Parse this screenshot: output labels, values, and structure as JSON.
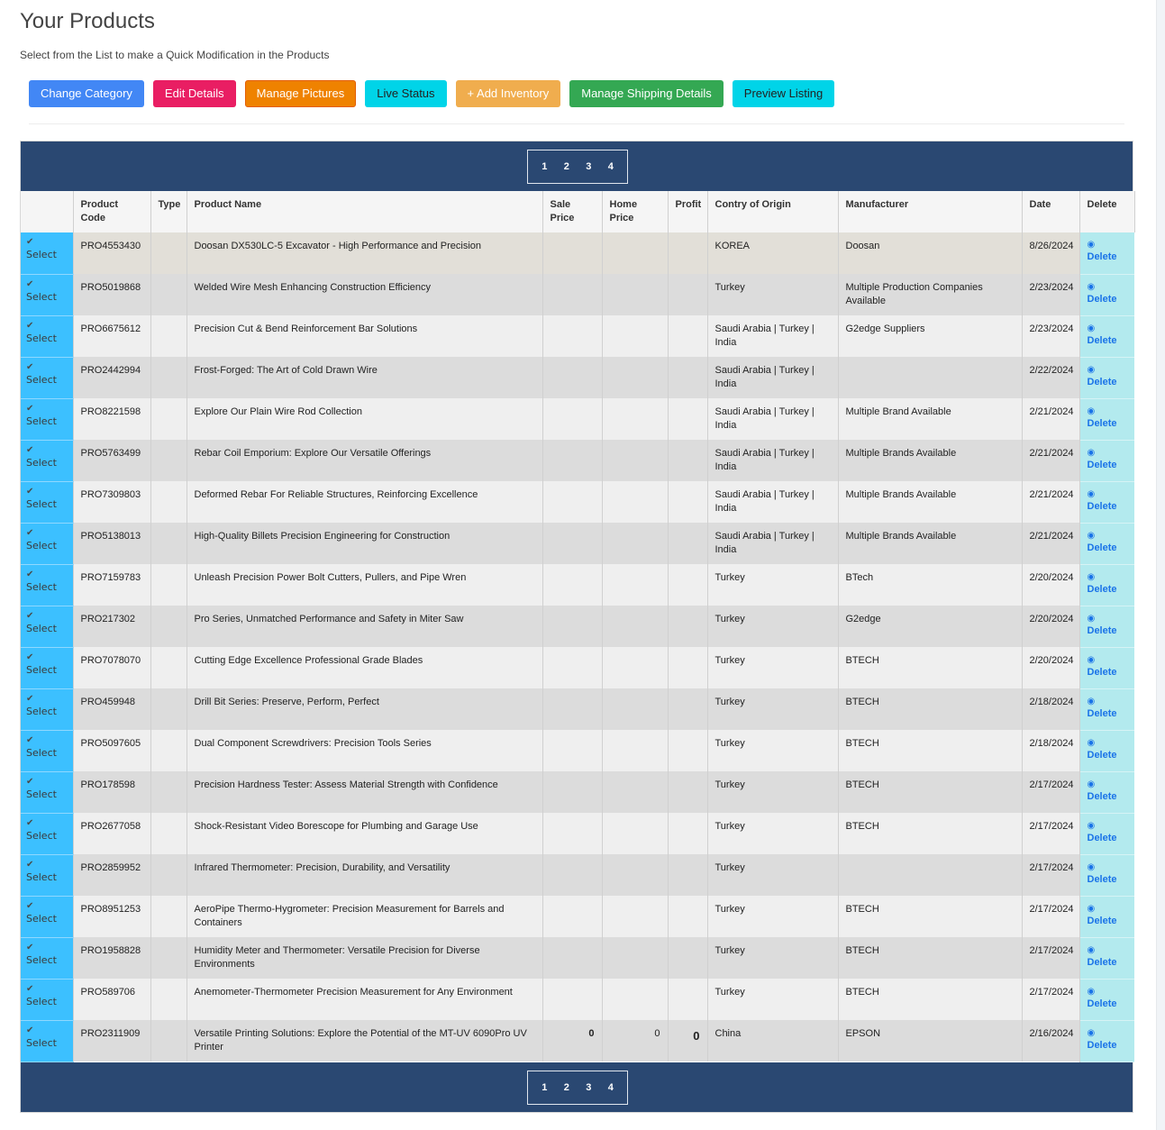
{
  "header": {
    "title": "Your Products",
    "subtitle": "Select from the List to make a Quick Modification in the Products"
  },
  "toolbar": {
    "change_category": "Change Category",
    "edit_details": "Edit Details",
    "manage_pictures": "Manage Pictures",
    "live_status": "Live Status",
    "add_inventory": "+ Add Inventory",
    "manage_shipping": "Manage Shipping Details",
    "preview_listing": "Preview Listing"
  },
  "pagination": {
    "pages": [
      "1",
      "2",
      "3",
      "4"
    ]
  },
  "table": {
    "columns": {
      "select": "",
      "code": "Product Code",
      "type": "Type",
      "name": "Product Name",
      "sale_price": "Sale Price",
      "home_price": "Home Price",
      "profit": "Profit",
      "origin": "Contry of Origin",
      "manufacturer": "Manufacturer",
      "date": "Date",
      "delete": "Delete"
    },
    "select_label": "Select",
    "delete_label": "Delete",
    "icons": {
      "select": "check-icon",
      "delete": "eye-icon"
    },
    "rows": [
      {
        "code": "PRO4553430",
        "type": "",
        "name": "Doosan DX530LC-5 Excavator - High Performance and Precision",
        "sale": "",
        "home": "",
        "profit": "",
        "origin": "KOREA",
        "manufacturer": "Doosan",
        "date": "8/26/2024"
      },
      {
        "code": "PRO5019868",
        "type": "",
        "name": "Welded Wire Mesh Enhancing Construction Efficiency",
        "sale": "",
        "home": "",
        "profit": "",
        "origin": "Turkey",
        "manufacturer": "Multiple Production Companies Available",
        "date": "2/23/2024"
      },
      {
        "code": "PRO6675612",
        "type": "",
        "name": "Precision Cut & Bend Reinforcement Bar Solutions",
        "sale": "",
        "home": "",
        "profit": "",
        "origin": "Saudi Arabia | Turkey | India",
        "manufacturer": "G2edge Suppliers",
        "date": "2/23/2024"
      },
      {
        "code": "PRO2442994",
        "type": "",
        "name": "Frost-Forged: The Art of Cold Drawn Wire",
        "sale": "",
        "home": "",
        "profit": "",
        "origin": "Saudi Arabia | Turkey | India",
        "manufacturer": "",
        "date": "2/22/2024"
      },
      {
        "code": "PRO8221598",
        "type": "",
        "name": "Explore Our Plain Wire Rod Collection",
        "sale": "",
        "home": "",
        "profit": "",
        "origin": "Saudi Arabia | Turkey | India",
        "manufacturer": "Multiple Brand Available",
        "date": "2/21/2024"
      },
      {
        "code": "PRO5763499",
        "type": "",
        "name": "Rebar Coil Emporium: Explore Our Versatile Offerings",
        "sale": "",
        "home": "",
        "profit": "",
        "origin": "Saudi Arabia | Turkey | India",
        "manufacturer": "Multiple Brands Available",
        "date": "2/21/2024"
      },
      {
        "code": "PRO7309803",
        "type": "",
        "name": "Deformed Rebar For Reliable Structures, Reinforcing Excellence",
        "sale": "",
        "home": "",
        "profit": "",
        "origin": "Saudi Arabia | Turkey | India",
        "manufacturer": "Multiple Brands Available",
        "date": "2/21/2024"
      },
      {
        "code": "PRO5138013",
        "type": "",
        "name": "High-Quality Billets Precision Engineering for Construction",
        "sale": "",
        "home": "",
        "profit": "",
        "origin": "Saudi Arabia | Turkey | India",
        "manufacturer": "Multiple Brands Available",
        "date": "2/21/2024"
      },
      {
        "code": "PRO7159783",
        "type": "",
        "name": "Unleash Precision Power Bolt Cutters, Pullers, and Pipe Wren",
        "sale": "",
        "home": "",
        "profit": "",
        "origin": "Turkey",
        "manufacturer": "BTech",
        "date": "2/20/2024"
      },
      {
        "code": "PRO217302",
        "type": "",
        "name": "Pro Series, Unmatched Performance and Safety in Miter Saw",
        "sale": "",
        "home": "",
        "profit": "",
        "origin": "Turkey",
        "manufacturer": "G2edge",
        "date": "2/20/2024"
      },
      {
        "code": "PRO7078070",
        "type": "",
        "name": "Cutting Edge Excellence Professional Grade Blades",
        "sale": "",
        "home": "",
        "profit": "",
        "origin": "Turkey",
        "manufacturer": "BTECH",
        "date": "2/20/2024"
      },
      {
        "code": "PRO459948",
        "type": "",
        "name": "Drill Bit Series: Preserve, Perform, Perfect",
        "sale": "",
        "home": "",
        "profit": "",
        "origin": "Turkey",
        "manufacturer": "BTECH",
        "date": "2/18/2024"
      },
      {
        "code": "PRO5097605",
        "type": "",
        "name": "Dual Component Screwdrivers: Precision Tools Series",
        "sale": "",
        "home": "",
        "profit": "",
        "origin": "Turkey",
        "manufacturer": "BTECH",
        "date": "2/18/2024"
      },
      {
        "code": "PRO178598",
        "type": "",
        "name": "Precision Hardness Tester: Assess Material Strength with Confidence",
        "sale": "",
        "home": "",
        "profit": "",
        "origin": "Turkey",
        "manufacturer": "BTECH",
        "date": "2/17/2024"
      },
      {
        "code": "PRO2677058",
        "type": "",
        "name": "Shock-Resistant Video Borescope for Plumbing and Garage Use",
        "sale": "",
        "home": "",
        "profit": "",
        "origin": "Turkey",
        "manufacturer": "BTECH",
        "date": "2/17/2024"
      },
      {
        "code": "PRO2859952",
        "type": "",
        "name": "Infrared Thermometer: Precision, Durability, and Versatility",
        "sale": "",
        "home": "",
        "profit": "",
        "origin": "Turkey",
        "manufacturer": "",
        "date": "2/17/2024"
      },
      {
        "code": "PRO8951253",
        "type": "",
        "name": "AeroPipe Thermo-Hygrometer: Precision Measurement for Barrels and Containers",
        "sale": "",
        "home": "",
        "profit": "",
        "origin": "Turkey",
        "manufacturer": "BTECH",
        "date": "2/17/2024"
      },
      {
        "code": "PRO1958828",
        "type": "",
        "name": "Humidity Meter and Thermometer: Versatile Precision for Diverse Environments",
        "sale": "",
        "home": "",
        "profit": "",
        "origin": "Turkey",
        "manufacturer": "BTECH",
        "date": "2/17/2024"
      },
      {
        "code": "PRO589706",
        "type": "",
        "name": "Anemometer-Thermometer Precision Measurement for Any Environment",
        "sale": "",
        "home": "",
        "profit": "",
        "origin": "Turkey",
        "manufacturer": "BTECH",
        "date": "2/17/2024"
      },
      {
        "code": "PRO2311909",
        "type": "",
        "name": "Versatile Printing Solutions: Explore the Potential of the MT-UV 6090Pro UV Printer",
        "sale": "0",
        "home": "0",
        "profit": "0",
        "origin": "China",
        "manufacturer": "EPSON",
        "date": "2/16/2024"
      }
    ]
  }
}
